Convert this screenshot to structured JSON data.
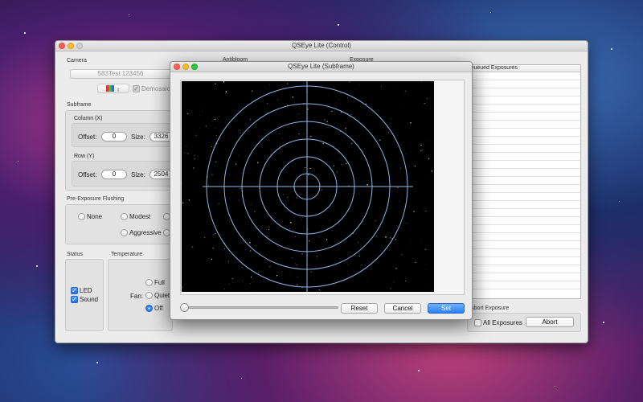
{
  "main_window": {
    "title": "QSEye Lite (Control)",
    "camera": {
      "section_label": "Camera",
      "selected_camera": "583Test 123456",
      "demosaic_label": "Demosaic",
      "demosaic_checked": true
    },
    "subframe": {
      "section_label": "Subframe",
      "column": {
        "label": "Column (X)",
        "offset_label": "Offset:",
        "offset_value": "0",
        "size_label": "Size:",
        "size_value": "3326"
      },
      "row": {
        "label": "Row (Y)",
        "offset_label": "Offset:",
        "offset_value": "0",
        "size_label": "Size:",
        "size_value": "2504"
      }
    },
    "flushing": {
      "section_label": "Pre-Exposure Flushing",
      "options": [
        "None",
        "Modest",
        "Aggressive"
      ]
    },
    "status": {
      "section_label": "Status",
      "led_label": "LED",
      "led_checked": true,
      "sound_label": "Sound",
      "sound_checked": true
    },
    "temperature": {
      "section_label": "Temperature",
      "fan_label": "Fan:",
      "fan_options": [
        "Full",
        "Quiet",
        "Off"
      ],
      "fan_selected": "Off"
    },
    "antibloom_label": "Antibloom",
    "exposure_label": "Exposure",
    "queue": {
      "header": "Queued Exposures",
      "rows": [
        "",
        "",
        "",
        "",
        "",
        "",
        "",
        "",
        "",
        "",
        "",
        "",
        "",
        "",
        "",
        "",
        "",
        "",
        "",
        "",
        "",
        "",
        "",
        "",
        "",
        "",
        ""
      ]
    },
    "abort": {
      "section_label": "Abort Exposure",
      "all_exposures_label": "All Exposures",
      "all_exposures_checked": false,
      "abort_button": "Abort"
    }
  },
  "subframe_window": {
    "title": "QSEye Lite (Subframe)",
    "reset_button": "Reset",
    "cancel_button": "Cancel",
    "set_button": "Set",
    "zoom_slider": 0.0,
    "reticle_color": "#8fb8e8"
  }
}
